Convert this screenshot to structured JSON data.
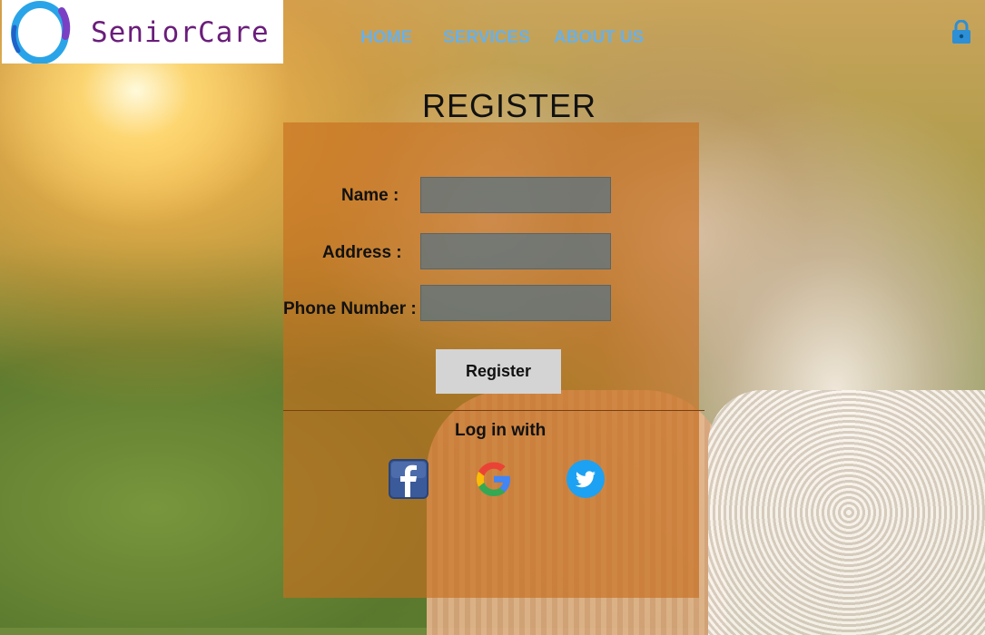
{
  "brand": {
    "name": "SeniorCare"
  },
  "nav": {
    "items": [
      {
        "label": "HOME"
      },
      {
        "label": "SERVICES"
      },
      {
        "label": "ABOUT US"
      }
    ],
    "account_icon": "lock-icon"
  },
  "register": {
    "title": "REGISTER",
    "fields": [
      {
        "label": "Name :",
        "value": "",
        "placeholder": ""
      },
      {
        "label": "Address :",
        "value": "",
        "placeholder": ""
      },
      {
        "label": "Phone Number :",
        "value": "",
        "placeholder": ""
      }
    ],
    "submit_label": "Register",
    "login_with_label": "Log in with",
    "social": [
      {
        "icon": "facebook-icon"
      },
      {
        "icon": "google-icon"
      },
      {
        "icon": "twitter-icon"
      }
    ]
  },
  "colors": {
    "nav_link": "#69b0e8",
    "panel": "#c86e1e",
    "brand_text": "#6a1d7a",
    "lock": "#2d8fd6"
  }
}
